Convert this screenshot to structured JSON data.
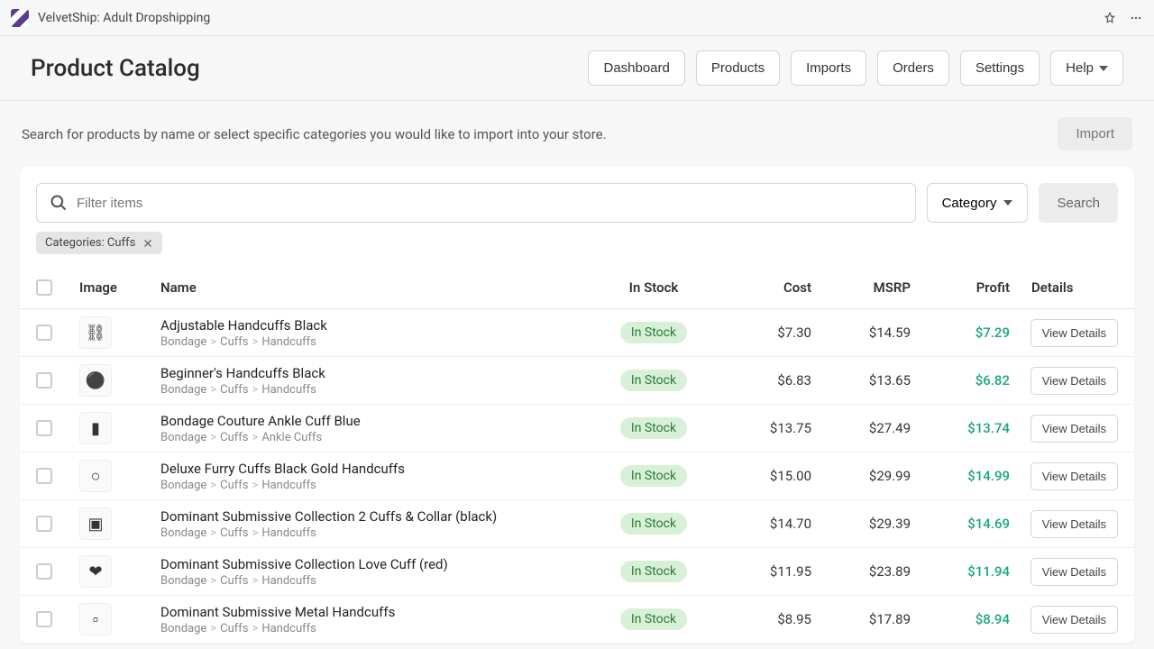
{
  "app": {
    "title": "VelvetShip: Adult Dropshipping"
  },
  "header": {
    "title": "Product Catalog",
    "nav": {
      "dashboard": "Dashboard",
      "products": "Products",
      "imports": "Imports",
      "orders": "Orders",
      "settings": "Settings",
      "help": "Help"
    }
  },
  "sub": {
    "desc": "Search for products by name or select specific categories you would like to import into your store.",
    "import": "Import"
  },
  "search": {
    "placeholder": "Filter items",
    "category_btn": "Category",
    "search_btn": "Search"
  },
  "chip": {
    "label": "Categories: Cuffs"
  },
  "columns": {
    "image": "Image",
    "name": "Name",
    "stock": "In Stock",
    "cost": "Cost",
    "msrp": "MSRP",
    "profit": "Profit",
    "details": "Details"
  },
  "stock_label": "In Stock",
  "view_label": "View Details",
  "rows": [
    {
      "name": "Adjustable Handcuffs Black",
      "crumbs": [
        "Bondage",
        "Cuffs",
        "Handcuffs"
      ],
      "cost": "$7.30",
      "msrp": "$14.59",
      "profit": "$7.29",
      "thumb": "⛓"
    },
    {
      "name": "Beginner's Handcuffs Black",
      "crumbs": [
        "Bondage",
        "Cuffs",
        "Handcuffs"
      ],
      "cost": "$6.83",
      "msrp": "$13.65",
      "profit": "$6.82",
      "thumb": "⚫"
    },
    {
      "name": "Bondage Couture Ankle Cuff Blue",
      "crumbs": [
        "Bondage",
        "Cuffs",
        "Ankle Cuffs"
      ],
      "cost": "$13.75",
      "msrp": "$27.49",
      "profit": "$13.74",
      "thumb": "▮"
    },
    {
      "name": "Deluxe Furry Cuffs Black Gold Handcuffs",
      "crumbs": [
        "Bondage",
        "Cuffs",
        "Handcuffs"
      ],
      "cost": "$15.00",
      "msrp": "$29.99",
      "profit": "$14.99",
      "thumb": "○"
    },
    {
      "name": "Dominant Submissive Collection 2 Cuffs & Collar (black)",
      "crumbs": [
        "Bondage",
        "Cuffs",
        "Handcuffs"
      ],
      "cost": "$14.70",
      "msrp": "$29.39",
      "profit": "$14.69",
      "thumb": "▣"
    },
    {
      "name": "Dominant Submissive Collection Love Cuff (red)",
      "crumbs": [
        "Bondage",
        "Cuffs",
        "Handcuffs"
      ],
      "cost": "$11.95",
      "msrp": "$23.89",
      "profit": "$11.94",
      "thumb": "❤"
    },
    {
      "name": "Dominant Submissive Metal Handcuffs",
      "crumbs": [
        "Bondage",
        "Cuffs",
        "Handcuffs"
      ],
      "cost": "$8.95",
      "msrp": "$17.89",
      "profit": "$8.94",
      "thumb": "▫"
    }
  ]
}
